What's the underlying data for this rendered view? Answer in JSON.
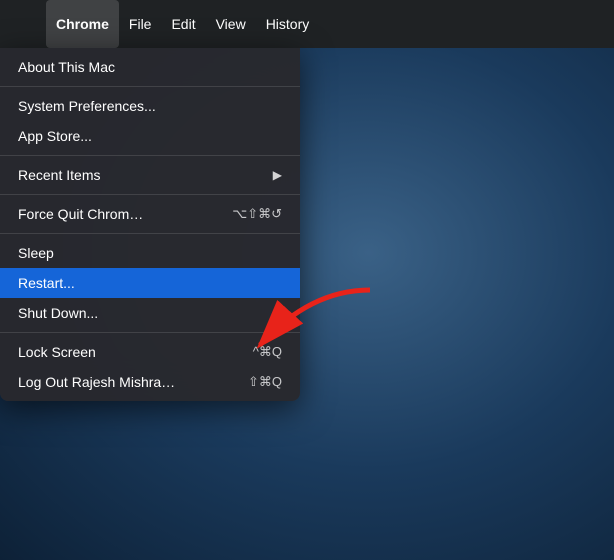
{
  "menubar": {
    "apple_symbol": "",
    "items": [
      {
        "label": "Chrome",
        "bold": true,
        "active": false
      },
      {
        "label": "File",
        "bold": false,
        "active": false
      },
      {
        "label": "Edit",
        "bold": false,
        "active": false
      },
      {
        "label": "View",
        "bold": false,
        "active": false
      },
      {
        "label": "History",
        "bold": false,
        "active": false
      }
    ]
  },
  "apple_menu": {
    "items": [
      {
        "id": "about",
        "label": "About This Mac",
        "shortcut": "",
        "has_arrow": false,
        "separator_after": true,
        "highlighted": false
      },
      {
        "id": "system-prefs",
        "label": "System Preferences...",
        "shortcut": "",
        "has_arrow": false,
        "separator_after": false,
        "highlighted": false
      },
      {
        "id": "app-store",
        "label": "App Store...",
        "shortcut": "",
        "has_arrow": false,
        "separator_after": true,
        "highlighted": false
      },
      {
        "id": "recent-items",
        "label": "Recent Items",
        "shortcut": "",
        "has_arrow": true,
        "separator_after": true,
        "highlighted": false
      },
      {
        "id": "force-quit",
        "label": "Force Quit Chrom…",
        "shortcut": "⌥⇧⌘↺",
        "has_arrow": false,
        "separator_after": true,
        "highlighted": false
      },
      {
        "id": "sleep",
        "label": "Sleep",
        "shortcut": "",
        "has_arrow": false,
        "separator_after": false,
        "highlighted": false
      },
      {
        "id": "restart",
        "label": "Restart...",
        "shortcut": "",
        "has_arrow": false,
        "separator_after": false,
        "highlighted": true
      },
      {
        "id": "shutdown",
        "label": "Shut Down...",
        "shortcut": "",
        "has_arrow": false,
        "separator_after": true,
        "highlighted": false
      },
      {
        "id": "lock-screen",
        "label": "Lock Screen",
        "shortcut": "^⌘Q",
        "has_arrow": false,
        "separator_after": false,
        "highlighted": false
      },
      {
        "id": "logout",
        "label": "Log Out Rajesh Mishra…",
        "shortcut": "⇧⌘Q",
        "has_arrow": false,
        "separator_after": false,
        "highlighted": false
      }
    ]
  },
  "annotation": {
    "arrow_color": "#e8231a"
  }
}
